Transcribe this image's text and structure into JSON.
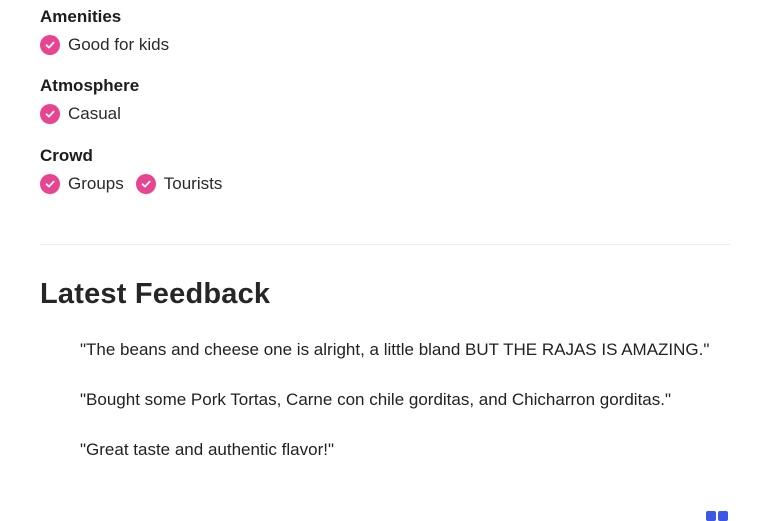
{
  "amenities": {
    "title": "Amenities",
    "tags": [
      "Good for kids"
    ]
  },
  "atmosphere": {
    "title": "Atmosphere",
    "tags": [
      "Casual"
    ]
  },
  "crowd": {
    "title": "Crowd",
    "tags": [
      "Groups",
      "Tourists"
    ]
  },
  "feedback": {
    "title": "Latest Feedback",
    "quotes": [
      "\"The beans and cheese one is alright, a little bland BUT THE RAJAS IS AMAZING.\"",
      "\"Bought some Pork Tortas, Carne con chile gorditas, and Chicharron gorditas.\"",
      "\"Great taste and authentic flavor!\""
    ]
  },
  "colors": {
    "check_badge": "#e8448f",
    "indicator": "#3a57e8"
  },
  "icons": {
    "tag_check": "checkmark-icon"
  }
}
